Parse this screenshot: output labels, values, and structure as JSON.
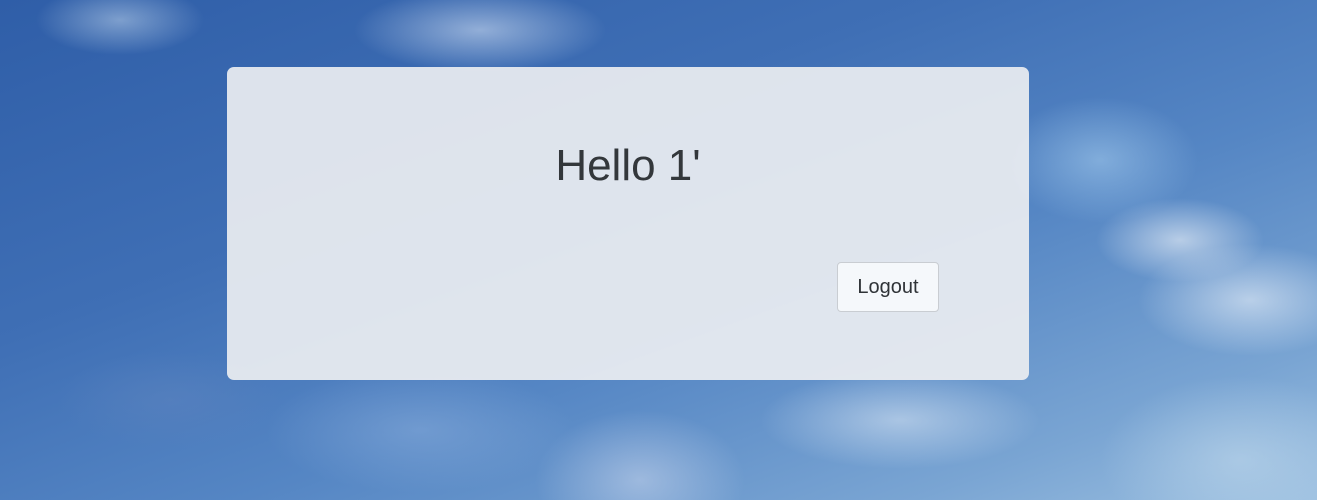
{
  "greeting": {
    "text": "Hello 1'"
  },
  "actions": {
    "logout_label": "Logout"
  },
  "colors": {
    "card_background": "#eceef1",
    "text": "#33373b",
    "button_background": "#f5f8fb",
    "button_border": "#c9cdd2"
  }
}
